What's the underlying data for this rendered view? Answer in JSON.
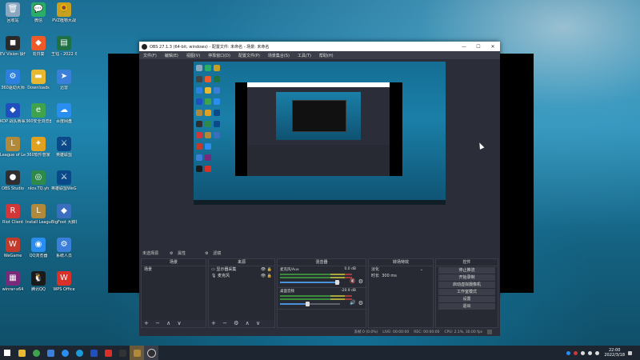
{
  "desktop": {
    "icons": [
      {
        "label": "回收站",
        "icon": "recycle-bin-icon",
        "color": "#8aa7bf",
        "glyph": "🗑"
      },
      {
        "label": "微信",
        "icon": "wechat-icon",
        "color": "#2aae67",
        "glyph": "💬"
      },
      {
        "label": "PVZ植物大战",
        "icon": "pvz-icon",
        "color": "#c8a020",
        "glyph": "🌻"
      },
      {
        "label": "EV Vision 操作控制",
        "icon": "ev-icon",
        "color": "#2a2a2a",
        "glyph": "◼"
      },
      {
        "label": "向日葵",
        "icon": "sunflower-icon",
        "color": "#f05a28",
        "glyph": "◆"
      },
      {
        "label": "王钰 - 2022 年度",
        "icon": "spreadsheet-icon",
        "color": "#1e7145",
        "glyph": "▤"
      },
      {
        "label": "360驱动大师",
        "icon": "driver-icon",
        "color": "#2d7fe0",
        "glyph": "⚙"
      },
      {
        "label": "Downloads",
        "icon": "folder-icon",
        "color": "#e8b830",
        "glyph": "▬"
      },
      {
        "label": "迅雷",
        "icon": "xunlei-icon",
        "color": "#3a7fd9",
        "glyph": "➤"
      },
      {
        "label": "KOP 战队赛事直播",
        "icon": "kop-icon",
        "color": "#2050c0",
        "glyph": "◆"
      },
      {
        "label": "360安全浏览器",
        "icon": "browser-icon",
        "color": "#3fa34d",
        "glyph": "e"
      },
      {
        "label": "百度网盘",
        "icon": "cloud-icon",
        "color": "#2a8ef0",
        "glyph": "☁"
      },
      {
        "label": "League of Legends",
        "icon": "lol-icon",
        "color": "#b08a3a",
        "glyph": "L"
      },
      {
        "label": "360软件管家",
        "icon": "software-icon",
        "color": "#e0a020",
        "glyph": "✦"
      },
      {
        "label": "英雄联盟",
        "icon": "game-icon",
        "color": "#0a4a8a",
        "glyph": "⚔"
      },
      {
        "label": "OBS Studio",
        "icon": "obs-icon",
        "color": "#302e31",
        "glyph": "●"
      },
      {
        "label": "nlov.TQ.yh",
        "icon": "app-icon",
        "color": "#2d8a4a",
        "glyph": "◎"
      },
      {
        "label": "英雄联盟WeGame版",
        "icon": "wegame-lol-icon",
        "color": "#0a4a8a",
        "glyph": "⚔"
      },
      {
        "label": "Riot Client",
        "icon": "riot-icon",
        "color": "#d13639",
        "glyph": "R"
      },
      {
        "label": "Install League of ...",
        "icon": "installer-icon",
        "color": "#b08a3a",
        "glyph": "L"
      },
      {
        "label": "BigFoot 大脚插件",
        "icon": "bigfoot-icon",
        "color": "#3a6fc0",
        "glyph": "◆"
      },
      {
        "label": "WeGame",
        "icon": "wegame-icon",
        "color": "#c33a2a",
        "glyph": "W"
      },
      {
        "label": "QQ浏览器",
        "icon": "qq-browser-icon",
        "color": "#2a8ef0",
        "glyph": "◉"
      },
      {
        "label": "系统人员",
        "icon": "system-icon",
        "color": "#3a7fd9",
        "glyph": "⚙"
      },
      {
        "label": "winrar-x64",
        "icon": "winrar-icon",
        "color": "#7a2a7a",
        "glyph": "▦"
      },
      {
        "label": "腾讯QQ",
        "icon": "qq-icon",
        "color": "#1a1a1a",
        "glyph": "🐧"
      },
      {
        "label": "WPS Office",
        "icon": "wps-icon",
        "color": "#d9302a",
        "glyph": "W"
      }
    ]
  },
  "obs": {
    "title": "OBS 27.1.3 (64-bit, windows) - 配置文件: 未命名 - 场景: 未命名",
    "menu": [
      "文件(F)",
      "编辑(E)",
      "视图(V)",
      "停靠窗口(D)",
      "配置文件(P)",
      "场景集合(S)",
      "工具(T)",
      "帮助(H)"
    ],
    "dock_tabs": [
      "未选择源",
      "属性",
      "滤镜"
    ],
    "scenes": {
      "title": "场景",
      "items": [
        "场景"
      ],
      "footer": "+ − ∧ ∨"
    },
    "sources": {
      "title": "来源",
      "items": [
        "显示器采集",
        "麦克风"
      ],
      "footer": "+ − ⚙ ∧ ∨"
    },
    "mixer": {
      "title": "混音器",
      "tracks": [
        {
          "name": "麦克风/Aux",
          "db": "0.0 dB",
          "level": 0.95
        },
        {
          "name": "桌面音频",
          "db": "-20.9 dB",
          "level": 0.45
        }
      ]
    },
    "transitions": {
      "title": "转场特效",
      "type": "淡化",
      "duration_label": "时长",
      "duration": "300 ms"
    },
    "controls": {
      "title": "控件",
      "buttons": [
        "停止推流",
        "开始录制",
        "启动虚拟摄像机",
        "工作室模式",
        "设置",
        "退出"
      ]
    },
    "status": {
      "dropped": "丢帧 0 (0.0%)",
      "live": "LIVE: 00:00:00",
      "rec": "REC: 00:00:00",
      "cpu": "CPU: 2.1%, 30.00 fps"
    }
  },
  "taskbar": {
    "time": "22:00",
    "date": "2022/3/18"
  }
}
